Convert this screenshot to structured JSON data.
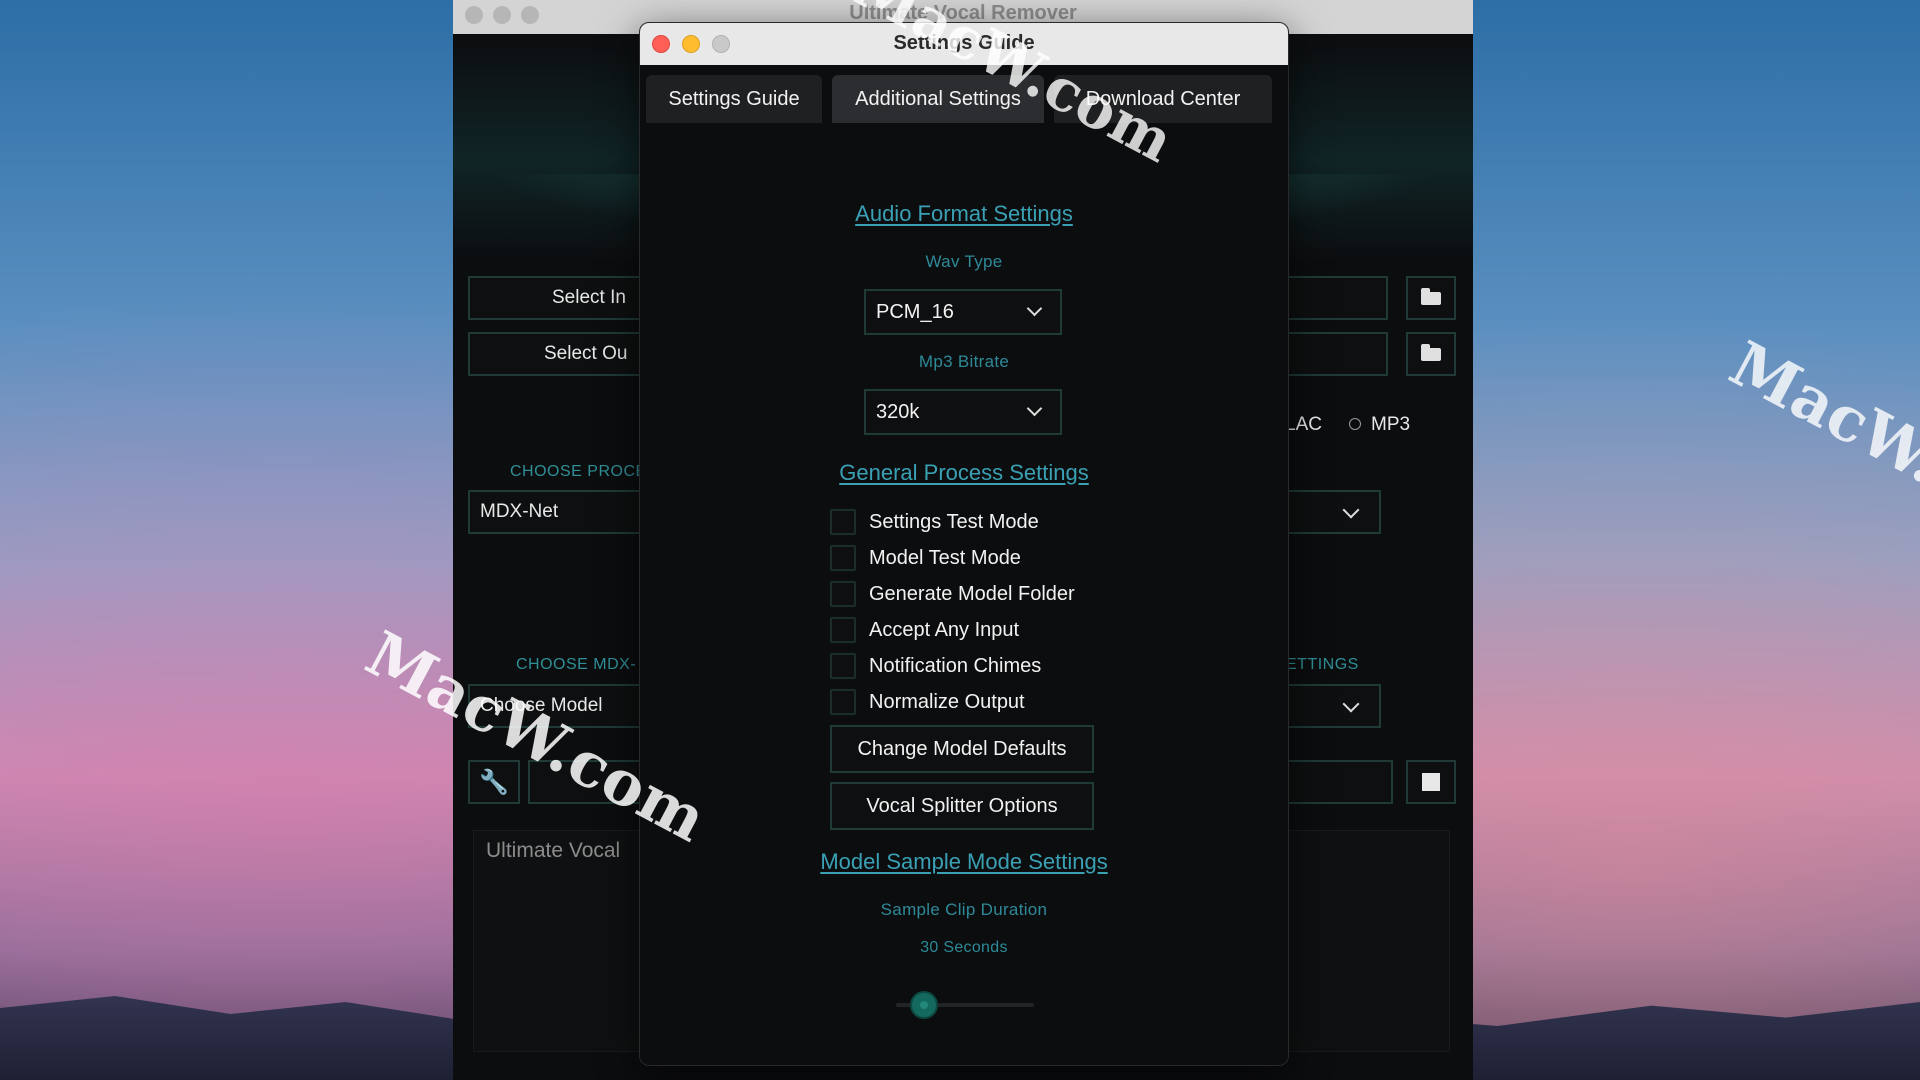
{
  "main_window": {
    "title": "Ultimate Vocal Remover",
    "select_input_label": "Select In",
    "select_output_label": "Select Ou",
    "format_options": [
      "LAC",
      "MP3"
    ],
    "choose_process_label": "CHOOSE PROCE",
    "process_value": "MDX-Net",
    "choose_model_label": "CHOOSE MDX-",
    "model_settings_label": "ETTINGS",
    "model_value": "Choose Model",
    "console_text": "Ultimate Vocal"
  },
  "dialog": {
    "title": "Settings Guide",
    "tabs": [
      {
        "label": "Settings Guide"
      },
      {
        "label": "Additional Settings",
        "active": true
      },
      {
        "label": "Download Center"
      }
    ],
    "audio_format": {
      "title": "Audio Format Settings",
      "wav_type_label": "Wav Type",
      "wav_type_value": "PCM_16",
      "mp3_bitrate_label": "Mp3 Bitrate",
      "mp3_bitrate_value": "320k"
    },
    "general_process": {
      "title": "General Process Settings",
      "options": [
        {
          "label": "Settings Test Mode",
          "checked": false
        },
        {
          "label": "Model Test Mode",
          "checked": false
        },
        {
          "label": "Generate Model Folder",
          "checked": false
        },
        {
          "label": "Accept Any Input",
          "checked": false
        },
        {
          "label": "Notification Chimes",
          "checked": false
        },
        {
          "label": "Normalize Output",
          "checked": false
        }
      ],
      "change_model_defaults_label": "Change Model Defaults",
      "vocal_splitter_label": "Vocal Splitter Options"
    },
    "sample_mode": {
      "title": "Model Sample Mode Settings",
      "clip_duration_label": "Sample Clip Duration",
      "clip_duration_value": "30 Seconds",
      "slider_fraction": 0.2
    }
  },
  "watermark": {
    "text": "MacW.com",
    "partial_text": "MacW.c"
  },
  "colors": {
    "accent": "#3aa0b4",
    "label": "#2e8a98",
    "border": "#1f3b38",
    "close": "#ff5f57",
    "minimize": "#febc2e"
  }
}
